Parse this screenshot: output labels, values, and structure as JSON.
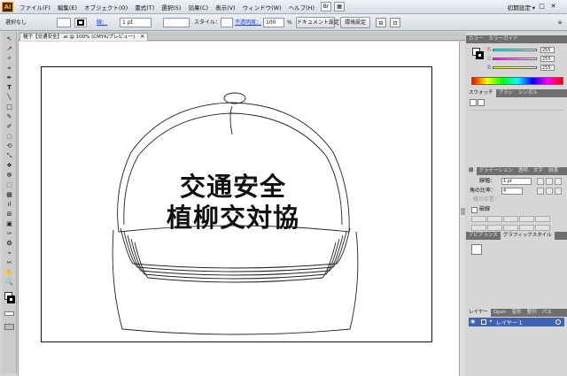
{
  "app": {
    "logo": "Ai",
    "menus": [
      "ファイル(F)",
      "編集(E)",
      "オブジェクト(O)",
      "書式(T)",
      "選択(S)",
      "効果(C)",
      "表示(V)",
      "ウィンドウ(W)",
      "ヘルプ(H)"
    ],
    "workspace": "初期設定 ▾",
    "window_controls": [
      "–",
      "□",
      "✕"
    ]
  },
  "control_bar": {
    "selection": "選択なし",
    "stroke_label": "線：",
    "stroke_value": "1 pt",
    "style_label": "スタイル：",
    "opacity_label": "不透明度：",
    "opacity_value": "100",
    "opacity_unit": "%",
    "doc_settings": "ドキュメント設定",
    "preferences": "環境設定"
  },
  "document": {
    "tab": "帽子【交通安全】.ai @ 100% (CMYK/プレビュー)",
    "close": "✕",
    "cap_text_line1": "交通安全",
    "cap_text_line2": "植柳交対協"
  },
  "tools": [
    "↖",
    "↗",
    "✧",
    "⌖",
    "✒",
    "T",
    "╲",
    "□",
    "✎",
    "✐",
    "◌",
    "⟲",
    "⤡",
    "❖",
    "☸",
    "⬚",
    "▦",
    "ıl",
    "⊞",
    "▣",
    "✑",
    "❂",
    "⌁",
    "✂",
    "✋",
    "🔍"
  ],
  "panels": {
    "color": {
      "tabs": [
        "カラー",
        "カラーガイド"
      ],
      "channels": [
        {
          "label": "R",
          "value": "255",
          "color": "#e64545"
        },
        {
          "label": "G",
          "value": "255",
          "color": "#3fbf3f"
        },
        {
          "label": "B",
          "value": "255",
          "color": "#4a5fe0"
        }
      ]
    },
    "swatch": {
      "tabs": [
        "スウォッチ",
        "ブラシ",
        "シンボル"
      ]
    },
    "stroke": {
      "tabs": [
        "線",
        "グラデーション",
        "透明",
        "文字",
        "段落"
      ],
      "weight_label": "線幅：",
      "weight_value": "1 pt",
      "miter_label": "角の比率：",
      "miter_value": "4",
      "align_label": "線の位置：",
      "dashed_label": "破線"
    },
    "appearance": {
      "tabs": [
        "アピアランス",
        "グラフィックスタイル"
      ]
    },
    "layers": {
      "tabs": [
        "レイヤー",
        "Open",
        "変形",
        "整列",
        "パス"
      ],
      "layer_name": "レイヤー 1"
    }
  },
  "colors": {
    "chrome": "#d4d4d4",
    "panel_header": "#6f6f6f",
    "layer_selected": "#3f63b5",
    "accent_link": "#1d3fd1"
  }
}
